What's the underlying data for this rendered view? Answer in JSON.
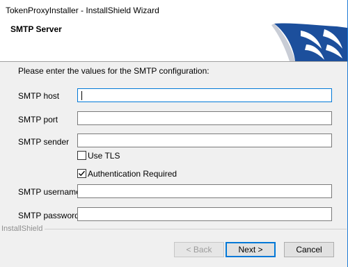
{
  "window": {
    "title": "TokenProxyInstaller - InstallShield Wizard"
  },
  "header": {
    "title": "SMTP Server"
  },
  "form": {
    "prompt": "Please enter the values for the SMTP configuration:",
    "fields": {
      "host": {
        "label": "SMTP host",
        "value": ""
      },
      "port": {
        "label": "SMTP port",
        "value": ""
      },
      "sender": {
        "label": "SMTP sender",
        "value": ""
      },
      "username": {
        "label": "SMTP username",
        "value": ""
      },
      "password": {
        "label": "SMTP password",
        "value": ""
      }
    },
    "checkboxes": {
      "use_tls": {
        "label": "Use TLS",
        "checked": false
      },
      "auth_required": {
        "label": "Authentication Required",
        "checked": true
      }
    }
  },
  "footer": {
    "brand": "InstallShield"
  },
  "buttons": {
    "back": "< Back",
    "next": "Next >",
    "cancel": "Cancel"
  },
  "colors": {
    "focus_border": "#0078d7",
    "logo_blue": "#1c4f9c",
    "window_bg": "#f0f0f0"
  }
}
